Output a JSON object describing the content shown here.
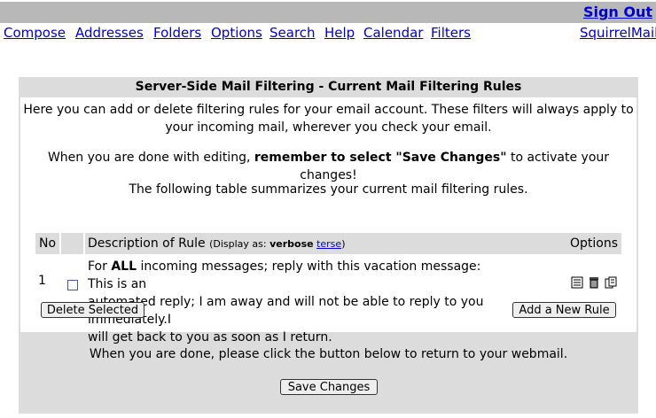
{
  "header": {
    "signout": "Sign Out"
  },
  "nav": {
    "items": [
      "Compose",
      "Addresses",
      "Folders",
      "Options",
      "Search",
      "Help",
      "Calendar",
      "Filters"
    ],
    "brand": "SquirrelMail"
  },
  "panel": {
    "title": "Server-Side Mail Filtering - Current Mail Filtering Rules",
    "intro_line1": "Here you can add or delete filtering rules for your email account. These filters will always apply to",
    "intro_line2": "your incoming mail, wherever you check your email.",
    "reminder_prefix": "When you are done with editing, ",
    "reminder_bold": "remember to select \"Save Changes\"",
    "reminder_suffix": " to activate your changes!",
    "summary": "The following table summarizes your current mail filtering rules."
  },
  "table": {
    "col_no": "No",
    "col_desc": "Description of Rule",
    "display_as_prefix": "(Display as: ",
    "display_verbose": "verbose",
    "display_terse": "terse",
    "display_as_suffix": ")",
    "col_options": "Options",
    "rows": [
      {
        "no": "1",
        "text_prefix": "For ",
        "text_bold": "ALL",
        "text_rest_line1": " incoming messages; reply with this vacation message: This is an",
        "text_line2": "automated reply; I am away and will not be able to reply to you immediately.I",
        "text_line3": "will get back to you as soon as I return."
      }
    ]
  },
  "buttons": {
    "delete_selected": "Delete Selected",
    "add_rule": "Add a New Rule",
    "save_changes": "Save Changes"
  },
  "footer": {
    "text": "When you are done, please click the button below to return to your webmail."
  },
  "icons": [
    "edit-icon",
    "trash-icon",
    "copy-icon"
  ]
}
